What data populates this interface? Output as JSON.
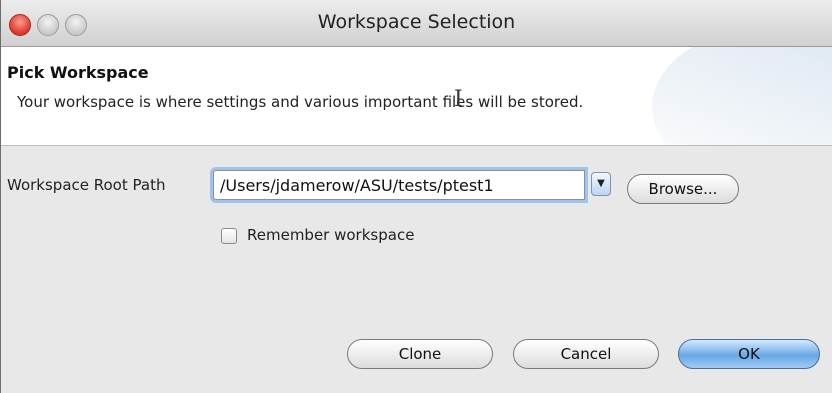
{
  "window": {
    "title": "Workspace Selection"
  },
  "header": {
    "title": "Pick Workspace",
    "description": "Your workspace is where settings and various important files will be stored."
  },
  "form": {
    "root_path_label": "Workspace Root Path",
    "root_path_value": "/Users/jdamerow/ASU/tests/ptest1",
    "browse_label": "Browse...",
    "remember_label": "Remember workspace",
    "remember_checked": false
  },
  "footer": {
    "clone_label": "Clone",
    "cancel_label": "Cancel",
    "ok_label": "OK"
  },
  "icons": {
    "dropdown": "chevron-down-icon",
    "cursor": "text-cursor-icon"
  },
  "colors": {
    "close_button": "#d9372b",
    "default_button": "#6aa7e6",
    "focus_ring": "#9ec3ee"
  }
}
